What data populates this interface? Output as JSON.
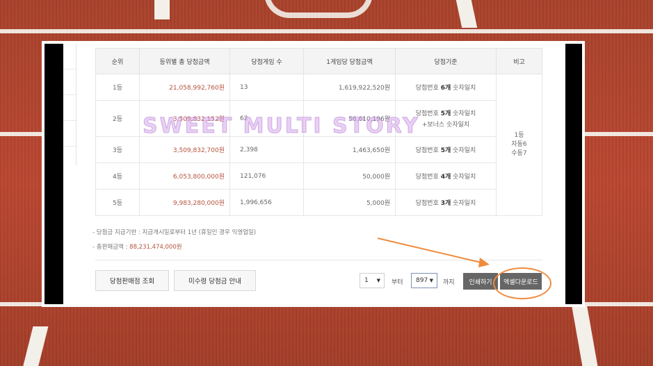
{
  "table": {
    "headers": [
      "순위",
      "등위별 총 당첨금액",
      "당첨게임 수",
      "1게임당 당첨금액",
      "당첨기준",
      "비고"
    ],
    "rows": [
      {
        "rank": "1등",
        "total": "21,058,992,760원",
        "games": "13",
        "per_game": "1,619,922,520원",
        "criteria_a": "당첨번호 ",
        "criteria_b": "6개",
        "criteria_c": " 숫자일치",
        "criteria_d": ""
      },
      {
        "rank": "2등",
        "total": "3,509,832,152원",
        "games": "62",
        "per_game": "56,610,196원",
        "criteria_a": "당첨번호 ",
        "criteria_b": "5개",
        "criteria_c": " 숫자일치",
        "criteria_d": "+보너스 숫자일치"
      },
      {
        "rank": "3등",
        "total": "3,509,832,700원",
        "games": "2,398",
        "per_game": "1,463,650원",
        "criteria_a": "당첨번호 ",
        "criteria_b": "5개",
        "criteria_c": " 숫자일치",
        "criteria_d": ""
      },
      {
        "rank": "4등",
        "total": "6,053,800,000원",
        "games": "121,076",
        "per_game": "50,000원",
        "criteria_a": "당첨번호 ",
        "criteria_b": "4개",
        "criteria_c": " 숫자일치",
        "criteria_d": ""
      },
      {
        "rank": "5등",
        "total": "9,983,280,000원",
        "games": "1,996,656",
        "per_game": "5,000원",
        "criteria_a": "당첨번호 ",
        "criteria_b": "3개",
        "criteria_c": " 숫자일치",
        "criteria_d": ""
      }
    ],
    "remark_lines": [
      "1등",
      "자동6",
      "수동7"
    ]
  },
  "notes": {
    "deadline": "당첨금 지급기한 : 지급개시일로부터 1년 (휴일인 경우 익영업일)",
    "sales_label": "총판매금액 : ",
    "sales_value": "88,231,474,000원"
  },
  "buttons": {
    "store_lookup": "당첨판매점 조회",
    "unclaimed": "미수령 당첨금 안내",
    "print": "인쇄하기",
    "excel": "엑셀다운로드"
  },
  "range": {
    "from_value": "1",
    "from_label": "부터",
    "to_value": "897",
    "to_label": "까지"
  },
  "watermark": "SWEET MULTI STORY",
  "colors": {
    "accent_red": "#b5523c",
    "annotation_orange": "#f08a3c"
  }
}
